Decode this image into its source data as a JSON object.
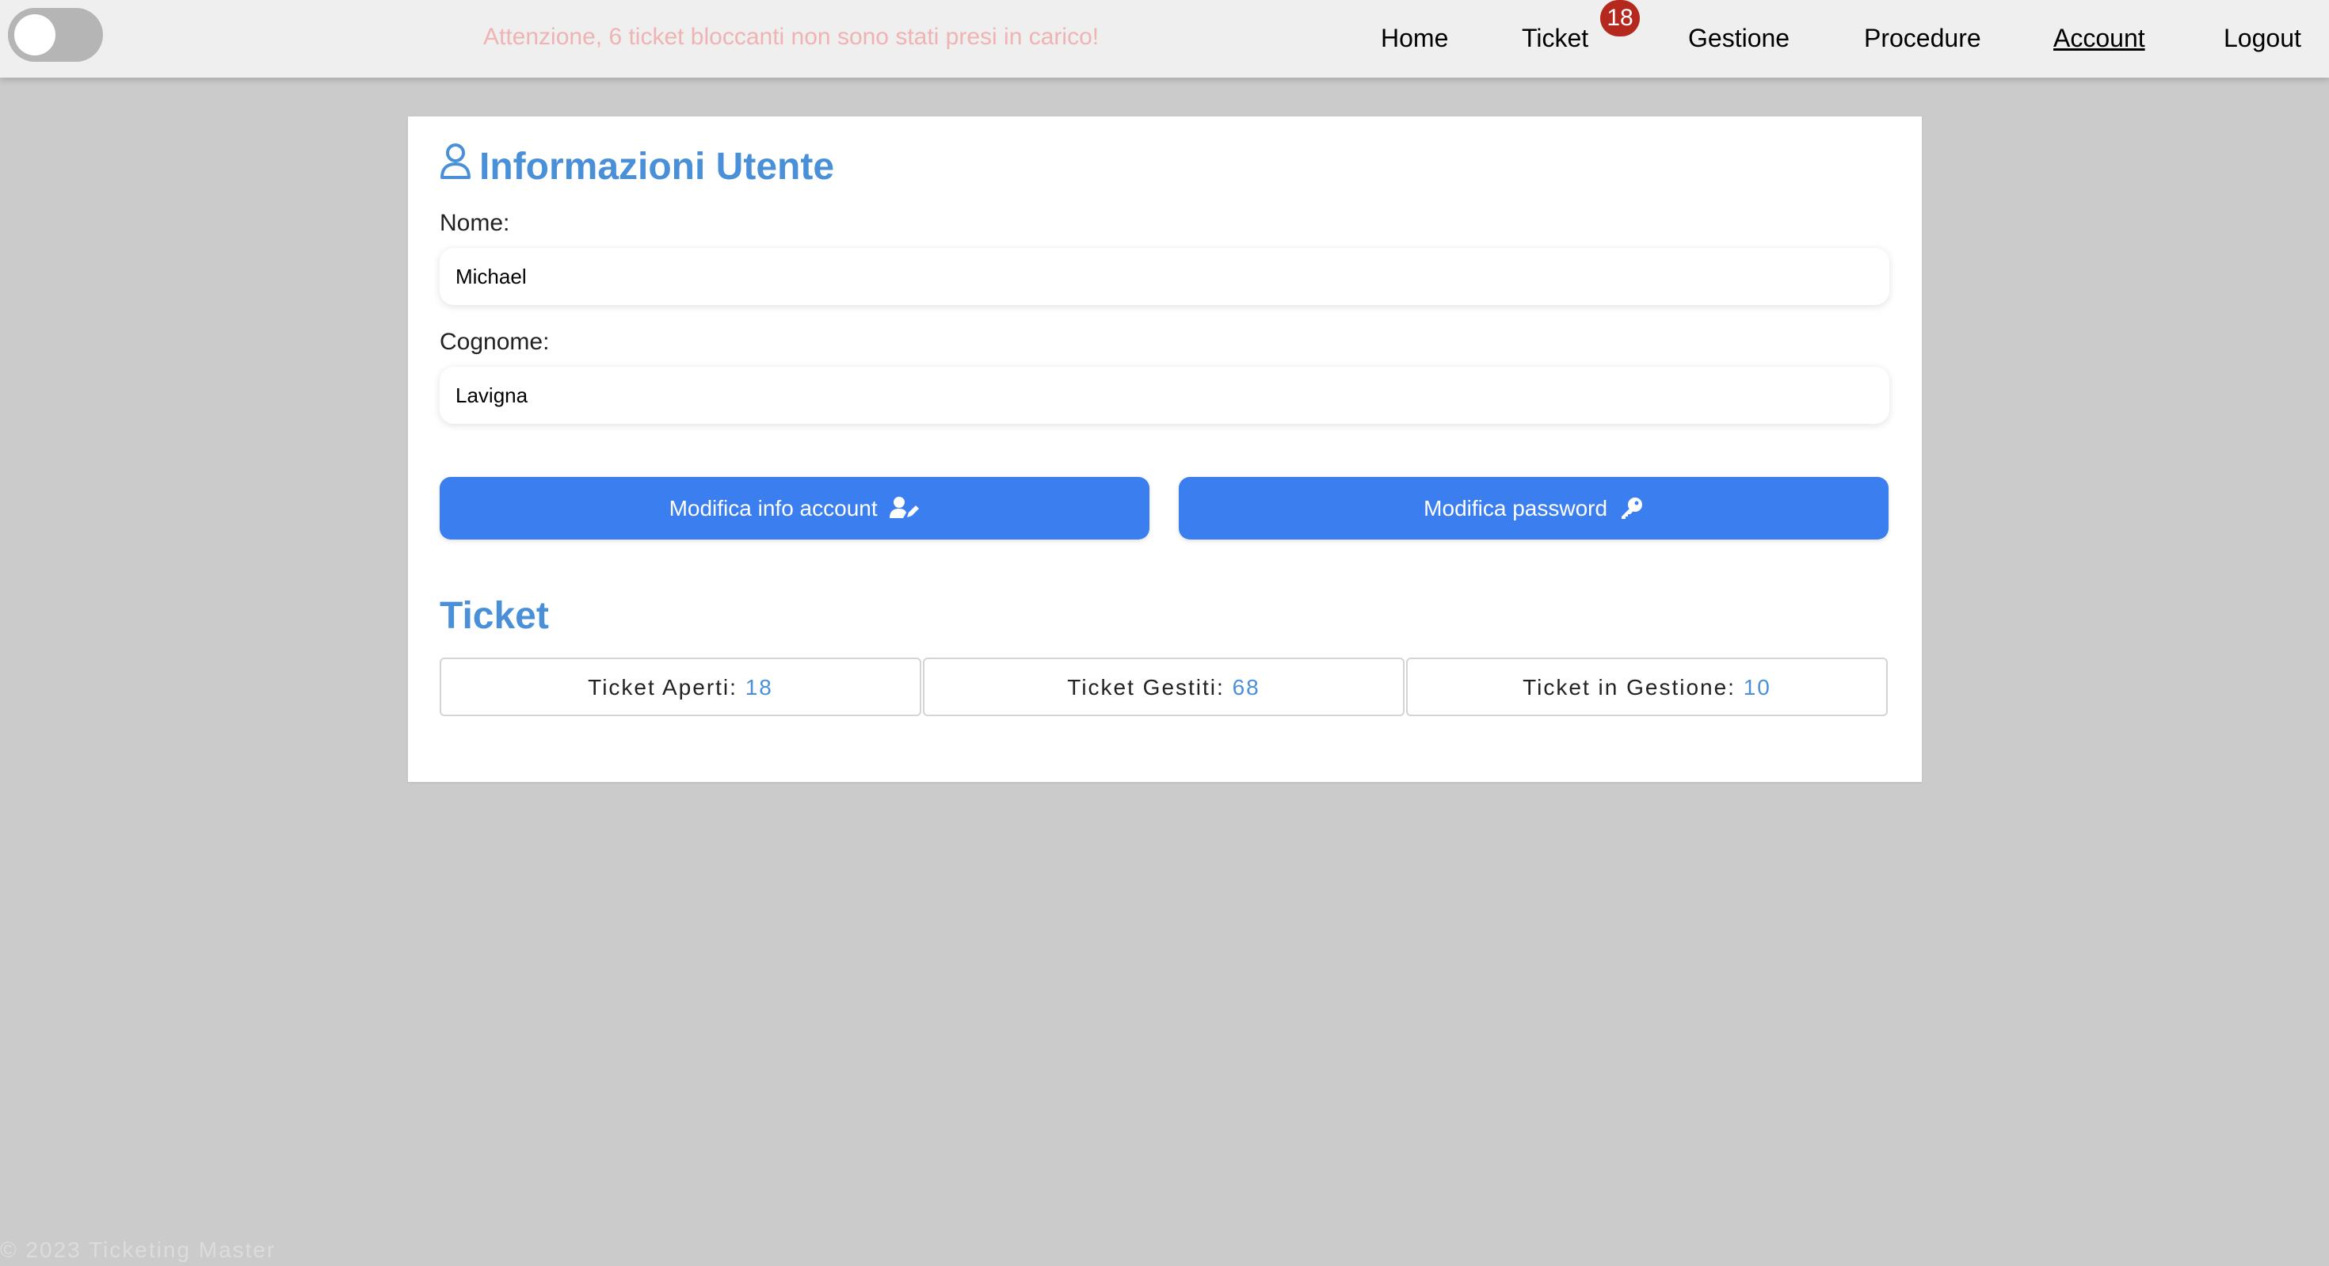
{
  "header": {
    "warning": "Attenzione, 6 ticket bloccanti non sono stati presi in carico!",
    "nav": {
      "home": "Home",
      "ticket": "Ticket",
      "ticket_badge": "18",
      "gestione": "Gestione",
      "procedure": "Procedure",
      "account": "Account",
      "logout": "Logout"
    }
  },
  "user_info": {
    "title": "Informazioni Utente",
    "nome_label": "Nome:",
    "nome_value": "Michael",
    "cognome_label": "Cognome:",
    "cognome_value": "Lavigna",
    "edit_account_button": "Modifica info account",
    "edit_password_button": "Modifica password"
  },
  "tickets": {
    "title": "Ticket",
    "stats": [
      {
        "label": "Ticket Aperti:",
        "value": "18"
      },
      {
        "label": "Ticket Gestiti:",
        "value": "68"
      },
      {
        "label": "Ticket in Gestione:",
        "value": "10"
      }
    ]
  },
  "footer": {
    "text": "© 2023 Ticketing Master"
  },
  "colors": {
    "accent": "#4a90d9",
    "button": "#3a7ef0",
    "badge": "#b5281e",
    "warning": "#efb3b3"
  }
}
